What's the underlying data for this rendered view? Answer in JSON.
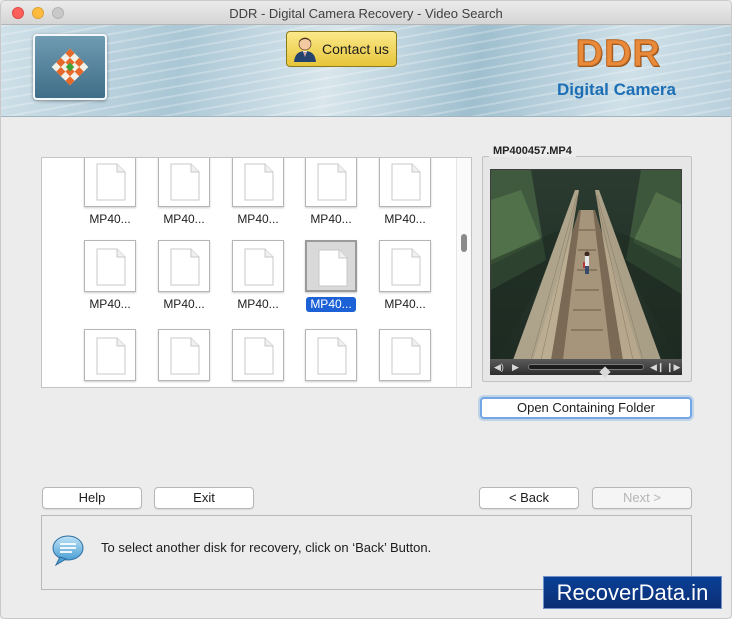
{
  "window": {
    "title": "DDR - Digital Camera Recovery - Video Search"
  },
  "header": {
    "contact_label": "Contact us",
    "brand_title": "DDR",
    "brand_subtitle": "Digital Camera"
  },
  "files": {
    "rows": [
      [
        "MP40...",
        "MP40...",
        "MP40...",
        "MP40...",
        "MP40..."
      ],
      [
        "MP40...",
        "MP40...",
        "MP40...",
        "MP40...",
        "MP40..."
      ],
      [
        "",
        "",
        "",
        "",
        ""
      ]
    ],
    "selected": {
      "row": 1,
      "col": 3
    }
  },
  "preview": {
    "filename": "MP400457.MP4",
    "open_folder_label": "Open Containing Folder"
  },
  "buttons": {
    "help": "Help",
    "exit": "Exit",
    "back": "< Back",
    "next": "Next >"
  },
  "message": {
    "text": "To select another disk for recovery, click on ‘Back’ Button."
  },
  "watermark": "RecoverData.in",
  "colors": {
    "selection": "#1c62d6",
    "brand_orange": "#e98a3b",
    "brand_blue": "#1d6fb5"
  }
}
